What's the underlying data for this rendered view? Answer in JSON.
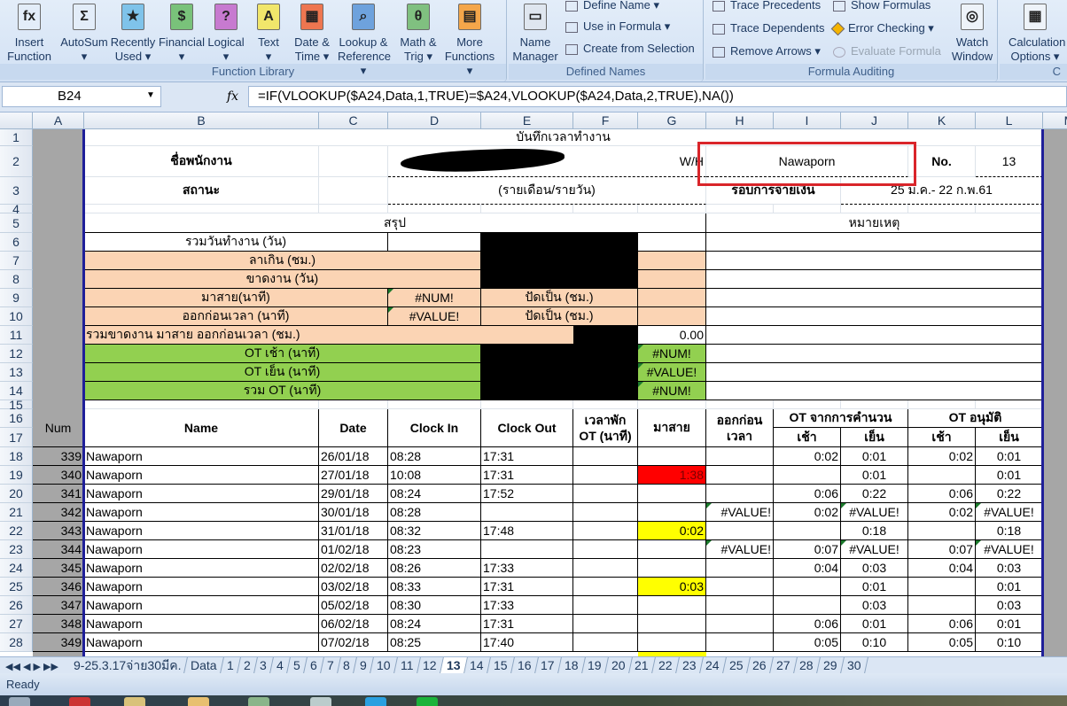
{
  "ribbon": {
    "big": [
      {
        "label": "Insert\nFunction",
        "icon": "fx",
        "color": "#e3edf9"
      },
      {
        "label": "AutoSum\n▾",
        "icon": "Σ",
        "color": "#e3edf9"
      },
      {
        "label": "Recently\nUsed ▾",
        "icon": "★",
        "color": "#7fc3ea"
      },
      {
        "label": "Financial\n▾",
        "icon": "$",
        "color": "#79c27a"
      },
      {
        "label": "Logical\n▾",
        "icon": "?",
        "color": "#c77ad0"
      },
      {
        "label": "Text\n▾",
        "icon": "A",
        "color": "#f1e66b"
      },
      {
        "label": "Date &\nTime ▾",
        "icon": "▦",
        "color": "#ee7650"
      },
      {
        "label": "Lookup &\nReference ▾",
        "icon": "⌕",
        "color": "#6ea2dd"
      },
      {
        "label": "Math &\nTrig ▾",
        "icon": "θ",
        "color": "#80c080"
      },
      {
        "label": "More\nFunctions ▾",
        "icon": "▤",
        "color": "#f4a64a"
      },
      {
        "label": "Name\nManager",
        "icon": "▭",
        "color": "#dfe6ef"
      },
      {
        "label": "Watch\nWindow",
        "icon": "◎",
        "color": "#eef3f9"
      },
      {
        "label": "Calculation\nOptions ▾",
        "icon": "▦",
        "color": "#eef3f9"
      }
    ],
    "small": {
      "define_name": "Define Name ▾",
      "use_in_formula": "Use in Formula ▾",
      "create_from_selection": "Create from Selection",
      "trace_precedents": "Trace Precedents",
      "trace_dependents": "Trace Dependents",
      "remove_arrows": "Remove Arrows ▾",
      "show_formulas": "Show Formulas",
      "error_checking": "Error Checking ▾",
      "evaluate_formula": "Evaluate Formula"
    },
    "groups": {
      "function_library": "Function Library",
      "defined_names": "Defined Names",
      "formula_auditing": "Formula Auditing",
      "calculation": "C"
    }
  },
  "formula_bar": {
    "name_box": "B24",
    "fx": "fx",
    "formula": "=IF(VLOOKUP($A24,Data,1,TRUE)=$A24,VLOOKUP($A24,Data,2,TRUE),NA())"
  },
  "columns": [
    "A",
    "B",
    "C",
    "D",
    "E",
    "F",
    "G",
    "H",
    "I",
    "J",
    "K",
    "L",
    "M"
  ],
  "rows": [
    "1",
    "2",
    "3",
    "4",
    "5",
    "6",
    "7",
    "8",
    "9",
    "10",
    "11",
    "12",
    "13",
    "14",
    "15",
    "16",
    "17",
    "18",
    "19",
    "20",
    "21",
    "22",
    "23",
    "24",
    "25",
    "26",
    "27",
    "28"
  ],
  "colors": {
    "peach": "#fbd4b4",
    "green": "#92d050",
    "black": "#000000",
    "gray": "#a6a6a6",
    "red": "#ff0000",
    "yellow": "#ffff00",
    "highlight_box": "#d9252a",
    "sheet_border": "#1f1f99"
  },
  "cells": [
    {
      "r": 1,
      "c": "B",
      "span": 11,
      "text": "บันทึกเวลาทำงาน",
      "cls": "c"
    },
    {
      "r": 2,
      "c": "B",
      "text": "ชื่อพนักงาน",
      "cls": "c b"
    },
    {
      "r": 2,
      "c": "D",
      "span": 4,
      "text": "W/H",
      "cls": "r",
      "dash": true,
      "redact": true
    },
    {
      "r": 2,
      "c": "H",
      "span": 3,
      "text": "Nawaporn",
      "cls": "c",
      "dash": true
    },
    {
      "r": 2,
      "c": "K",
      "text": "No.",
      "cls": "c b"
    },
    {
      "r": 2,
      "c": "L",
      "text": "13",
      "cls": "c",
      "dash": true
    },
    {
      "r": 3,
      "c": "B",
      "text": "สถานะ",
      "cls": "c b"
    },
    {
      "r": 3,
      "c": "D",
      "span": 4,
      "text": "(รายเดือน/รายวัน)",
      "cls": "c",
      "dash": true
    },
    {
      "r": 3,
      "c": "H",
      "span": 2,
      "text": "รอบการจ่ายเงิน",
      "cls": "c b"
    },
    {
      "r": 3,
      "c": "J",
      "span": 3,
      "text": "25 ม.ค.- 22 ก.พ.61",
      "cls": "c",
      "dash": true
    },
    {
      "r": 5,
      "c": "B",
      "span": 6,
      "text": "สรุป",
      "cls": "c bx"
    },
    {
      "r": 5,
      "c": "H",
      "span": 5,
      "text": "หมายเหตุ",
      "cls": "c bx"
    },
    {
      "r": 6,
      "c": "B",
      "span": 2,
      "text": "รวมวันทำงาน (วัน)",
      "cls": "c bx"
    },
    {
      "r": 6,
      "c": "D",
      "text": "",
      "cls": "bx"
    },
    {
      "r": 6,
      "c": "E",
      "span": 2,
      "rspan": 3,
      "text": "",
      "cls": "bx",
      "fill": "black"
    },
    {
      "r": 6,
      "c": "G",
      "text": "",
      "cls": "bx"
    },
    {
      "r": 7,
      "c": "B",
      "span": 3,
      "text": "ลาเกิน (ชม.)",
      "cls": "c bx",
      "fill": "peach"
    },
    {
      "r": 7,
      "c": "G",
      "text": "",
      "cls": "bx",
      "fill": "peach"
    },
    {
      "r": 8,
      "c": "B",
      "span": 3,
      "text": "ขาดงาน (วัน)",
      "cls": "c bx",
      "fill": "peach"
    },
    {
      "r": 8,
      "c": "G",
      "text": "",
      "cls": "bx",
      "fill": "peach"
    },
    {
      "r": 9,
      "c": "B",
      "span": 2,
      "text": "มาสาย(นาที)",
      "cls": "c bx",
      "fill": "peach"
    },
    {
      "r": 9,
      "c": "D",
      "text": "#NUM!",
      "cls": "c bx tri",
      "fill": "peach"
    },
    {
      "r": 9,
      "c": "E",
      "span": 2,
      "text": "ปัดเป็น (ชม.)",
      "cls": "c bx",
      "fill": "peach"
    },
    {
      "r": 9,
      "c": "G",
      "text": "",
      "cls": "bx",
      "fill": "peach"
    },
    {
      "r": 10,
      "c": "B",
      "span": 2,
      "text": "ออกก่อนเวลา (นาที)",
      "cls": "c bx",
      "fill": "peach"
    },
    {
      "r": 10,
      "c": "D",
      "text": "#VALUE!",
      "cls": "c bx tri",
      "fill": "peach"
    },
    {
      "r": 10,
      "c": "E",
      "span": 2,
      "text": "ปัดเป็น (ชม.)",
      "cls": "c bx",
      "fill": "peach"
    },
    {
      "r": 10,
      "c": "G",
      "text": "",
      "cls": "bx",
      "fill": "peach"
    },
    {
      "r": 11,
      "c": "B",
      "span": 5,
      "text": "รวมขาดงาน มาสาย ออกก่อนเวลา (ชม.)",
      "cls": "bx",
      "fill": "peach"
    },
    {
      "r": 11,
      "c": "F",
      "text": "",
      "cls": "bx",
      "fill": "black"
    },
    {
      "r": 11,
      "c": "G",
      "text": "0.00",
      "cls": "r bx"
    },
    {
      "r": 12,
      "c": "B",
      "span": 3,
      "text": "OT เช้า (นาที)",
      "cls": "c bx",
      "fill": "green"
    },
    {
      "r": 12,
      "c": "E",
      "span": 2,
      "rspan": 3,
      "text": "",
      "cls": "bx",
      "fill": "black"
    },
    {
      "r": 12,
      "c": "G",
      "text": "#NUM!",
      "cls": "c bx tri",
      "fill": "green"
    },
    {
      "r": 13,
      "c": "B",
      "span": 3,
      "text": "OT เย็น (นาที)",
      "cls": "c bx",
      "fill": "green"
    },
    {
      "r": 13,
      "c": "G",
      "text": "#VALUE!",
      "cls": "c bx tri",
      "fill": "green"
    },
    {
      "r": 14,
      "c": "B",
      "span": 3,
      "text": "รวม OT (นาที)",
      "cls": "c bx",
      "fill": "green"
    },
    {
      "r": 14,
      "c": "G",
      "text": "#NUM!",
      "cls": "c bx tri",
      "fill": "green"
    },
    {
      "r": 6,
      "c": "H",
      "span": 5,
      "text": "",
      "cls": "bx"
    },
    {
      "r": 7,
      "c": "H",
      "span": 5,
      "text": "",
      "cls": "bx"
    },
    {
      "r": 8,
      "c": "H",
      "span": 5,
      "text": "",
      "cls": "bx"
    },
    {
      "r": 9,
      "c": "H",
      "span": 5,
      "text": "",
      "cls": "bx"
    },
    {
      "r": 10,
      "c": "H",
      "span": 5,
      "text": "",
      "cls": "bx"
    },
    {
      "r": 11,
      "c": "H",
      "span": 5,
      "text": "",
      "cls": "bx"
    },
    {
      "r": 12,
      "c": "H",
      "span": 5,
      "text": "",
      "cls": "bx"
    },
    {
      "r": 13,
      "c": "H",
      "span": 5,
      "text": "",
      "cls": "bx"
    },
    {
      "r": 14,
      "c": "H",
      "span": 5,
      "text": "",
      "cls": "bx"
    },
    {
      "r": 16,
      "c": "A",
      "rspan": 2,
      "text": "Num",
      "cls": "c bx",
      "fill": "gray"
    },
    {
      "r": 16,
      "c": "B",
      "rspan": 2,
      "text": "Name",
      "cls": "c b bx"
    },
    {
      "r": 16,
      "c": "C",
      "rspan": 2,
      "text": "Date",
      "cls": "c b bx"
    },
    {
      "r": 16,
      "c": "D",
      "rspan": 2,
      "text": "Clock In",
      "cls": "c b bx"
    },
    {
      "r": 16,
      "c": "E",
      "rspan": 2,
      "text": "Clock Out",
      "cls": "c b bx"
    },
    {
      "r": 16,
      "c": "F",
      "rspan": 2,
      "text": "เวลาพัก\nOT (นาที)",
      "cls": "c b bx wrap"
    },
    {
      "r": 16,
      "c": "G",
      "rspan": 2,
      "text": "มาสาย",
      "cls": "c b bx"
    },
    {
      "r": 16,
      "c": "H",
      "rspan": 2,
      "text": "ออกก่อน\nเวลา",
      "cls": "c b bx wrap"
    },
    {
      "r": 16,
      "c": "I",
      "span": 2,
      "text": "OT จากการคำนวน",
      "cls": "c b bx"
    },
    {
      "r": 16,
      "c": "K",
      "span": 2,
      "text": "OT อนุมัติ",
      "cls": "c b bx"
    },
    {
      "r": 17,
      "c": "I",
      "text": "เช้า",
      "cls": "c b bx"
    },
    {
      "r": 17,
      "c": "J",
      "text": "เย็น",
      "cls": "c b bx"
    },
    {
      "r": 17,
      "c": "K",
      "text": "เช้า",
      "cls": "c b bx"
    },
    {
      "r": 17,
      "c": "L",
      "text": "เย็น",
      "cls": "c b bx"
    }
  ],
  "records": [
    [
      "339",
      "Nawaporn",
      "26/01/18",
      "08:28",
      "17:31",
      "",
      "",
      "",
      "0:02",
      "0:01",
      "0:02",
      "0:01"
    ],
    [
      "340",
      "Nawaporn",
      "27/01/18",
      "10:08",
      "17:31",
      "",
      "1:38",
      "",
      "",
      "0:01",
      "",
      "0:01"
    ],
    [
      "341",
      "Nawaporn",
      "29/01/18",
      "08:24",
      "17:52",
      "",
      "",
      "",
      "0:06",
      "0:22",
      "0:06",
      "0:22"
    ],
    [
      "342",
      "Nawaporn",
      "30/01/18",
      "08:28",
      "",
      "",
      "",
      "#VALUE!",
      "0:02",
      "#VALUE!",
      "0:02",
      "#VALUE!"
    ],
    [
      "343",
      "Nawaporn",
      "31/01/18",
      "08:32",
      "17:48",
      "",
      "0:02",
      "",
      "",
      "0:18",
      "",
      "0:18"
    ],
    [
      "344",
      "Nawaporn",
      "01/02/18",
      "08:23",
      "",
      "",
      "",
      "#VALUE!",
      "0:07",
      "#VALUE!",
      "0:07",
      "#VALUE!"
    ],
    [
      "345",
      "Nawaporn",
      "02/02/18",
      "08:26",
      "17:33",
      "",
      "",
      "",
      "0:04",
      "0:03",
      "0:04",
      "0:03"
    ],
    [
      "346",
      "Nawaporn",
      "03/02/18",
      "08:33",
      "17:31",
      "",
      "0:03",
      "",
      "",
      "0:01",
      "",
      "0:01"
    ],
    [
      "347",
      "Nawaporn",
      "05/02/18",
      "08:30",
      "17:33",
      "",
      "",
      "",
      "",
      "0:03",
      "",
      "0:03"
    ],
    [
      "348",
      "Nawaporn",
      "06/02/18",
      "08:24",
      "17:31",
      "",
      "",
      "",
      "0:06",
      "0:01",
      "0:06",
      "0:01"
    ],
    [
      "349",
      "Nawaporn",
      "07/02/18",
      "08:25",
      "17:40",
      "",
      "",
      "",
      "0:05",
      "0:10",
      "0:05",
      "0:10"
    ]
  ],
  "late_fill": {
    "1": "red",
    "4": "yellow",
    "7": "yellow"
  },
  "sheet_tabs": {
    "nav": "◀◀ ◀ ▶ ▶▶",
    "tabs": [
      "9-25.3.17จ่าย30มีค.",
      "Data",
      "1",
      "2",
      "3",
      "4",
      "5",
      "6",
      "7",
      "8",
      "9",
      "10",
      "11",
      "12",
      "13",
      "14",
      "15",
      "16",
      "17",
      "18",
      "19",
      "20",
      "21",
      "22",
      "23",
      "24",
      "25",
      "26",
      "27",
      "28",
      "29",
      "30"
    ],
    "active": "13"
  },
  "status": {
    "text": "Ready"
  }
}
